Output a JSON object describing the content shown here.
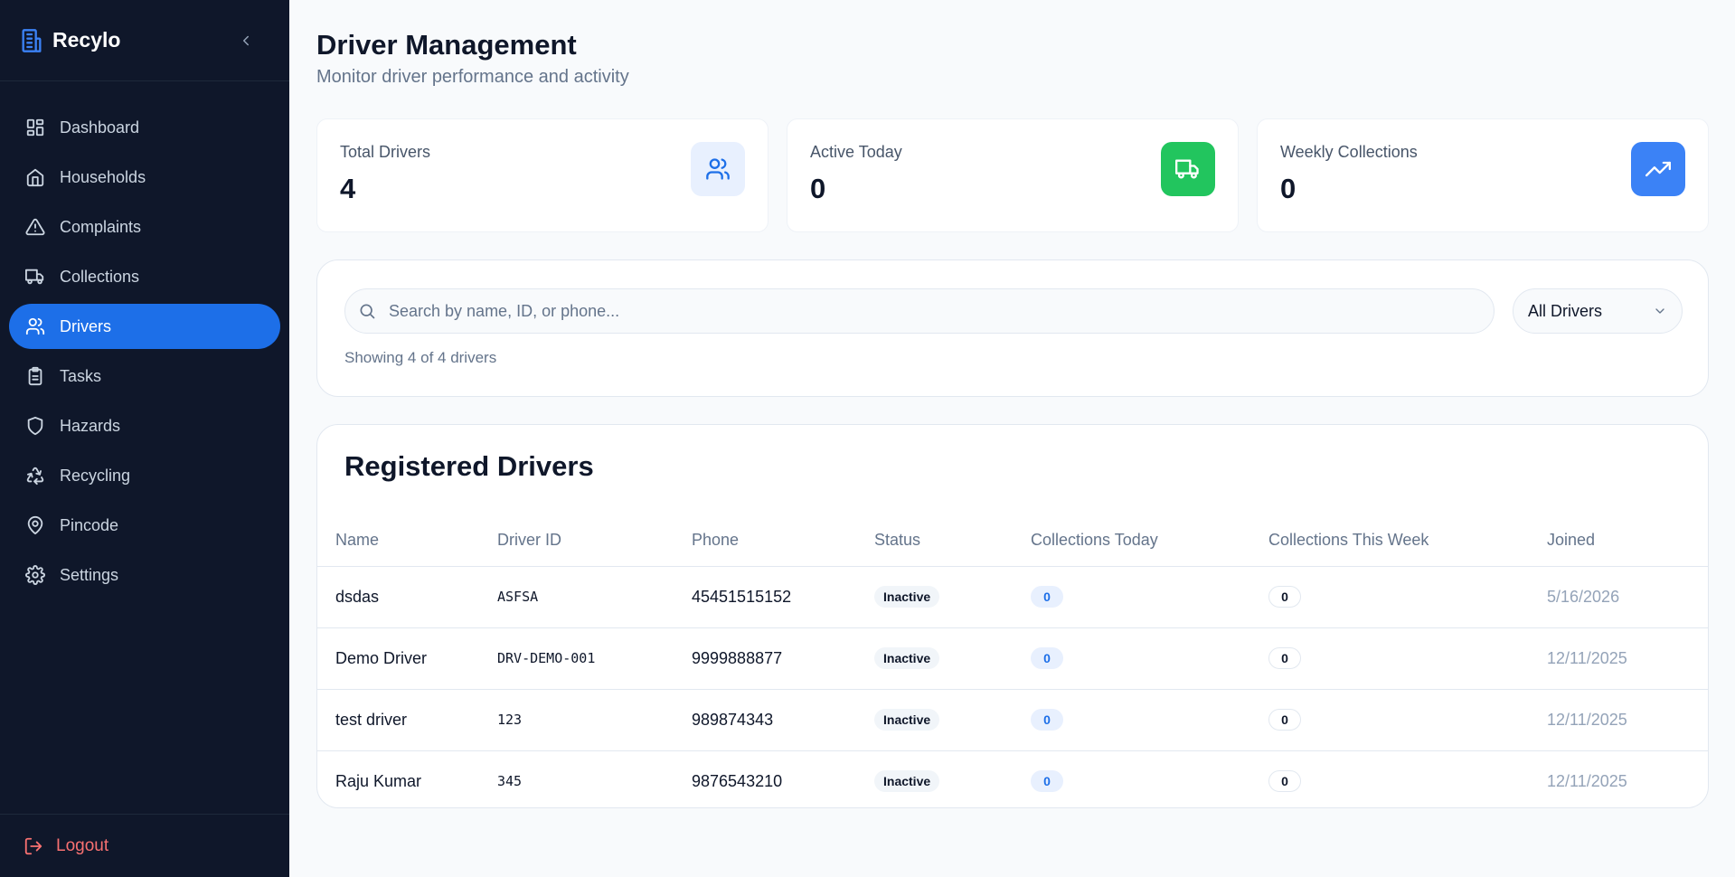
{
  "app": {
    "name": "Recylo"
  },
  "colors": {
    "sidebar_bg": "#0f172a",
    "accent": "#1d6fe8",
    "green": "#22c55e",
    "blue": "#3b82f6",
    "logout": "#f87171"
  },
  "sidebar": {
    "items": [
      {
        "label": "Dashboard",
        "icon": "dashboard-icon"
      },
      {
        "label": "Households",
        "icon": "home-icon"
      },
      {
        "label": "Complaints",
        "icon": "alert-triangle-icon"
      },
      {
        "label": "Collections",
        "icon": "truck-icon"
      },
      {
        "label": "Drivers",
        "icon": "users-icon",
        "active": true
      },
      {
        "label": "Tasks",
        "icon": "clipboard-icon"
      },
      {
        "label": "Hazards",
        "icon": "shield-icon"
      },
      {
        "label": "Recycling",
        "icon": "recycle-icon"
      },
      {
        "label": "Pincode",
        "icon": "map-pin-icon"
      },
      {
        "label": "Settings",
        "icon": "gear-icon"
      }
    ],
    "logout_label": "Logout"
  },
  "header": {
    "title": "Driver Management",
    "subtitle": "Monitor driver performance and activity"
  },
  "stats": [
    {
      "label": "Total Drivers",
      "value": "4",
      "icon": "users-icon"
    },
    {
      "label": "Active Today",
      "value": "0",
      "icon": "truck-icon"
    },
    {
      "label": "Weekly Collections",
      "value": "0",
      "icon": "trending-up-icon"
    }
  ],
  "filters": {
    "search_placeholder": "Search by name, ID, or phone...",
    "select_value": "All Drivers",
    "showing_text": "Showing 4 of 4 drivers"
  },
  "table": {
    "title": "Registered Drivers",
    "columns": [
      "Name",
      "Driver ID",
      "Phone",
      "Status",
      "Collections Today",
      "Collections This Week",
      "Joined"
    ],
    "rows": [
      {
        "name": "dsdas",
        "driver_id": "ASFSA",
        "phone": "45451515152",
        "status": "Inactive",
        "today": "0",
        "week": "0",
        "joined": "5/16/2026"
      },
      {
        "name": "Demo Driver",
        "driver_id": "DRV-DEMO-001",
        "phone": "9999888877",
        "status": "Inactive",
        "today": "0",
        "week": "0",
        "joined": "12/11/2025"
      },
      {
        "name": "test driver",
        "driver_id": "123",
        "phone": "989874343",
        "status": "Inactive",
        "today": "0",
        "week": "0",
        "joined": "12/11/2025"
      },
      {
        "name": "Raju Kumar",
        "driver_id": "345",
        "phone": "9876543210",
        "status": "Inactive",
        "today": "0",
        "week": "0",
        "joined": "12/11/2025"
      }
    ]
  }
}
